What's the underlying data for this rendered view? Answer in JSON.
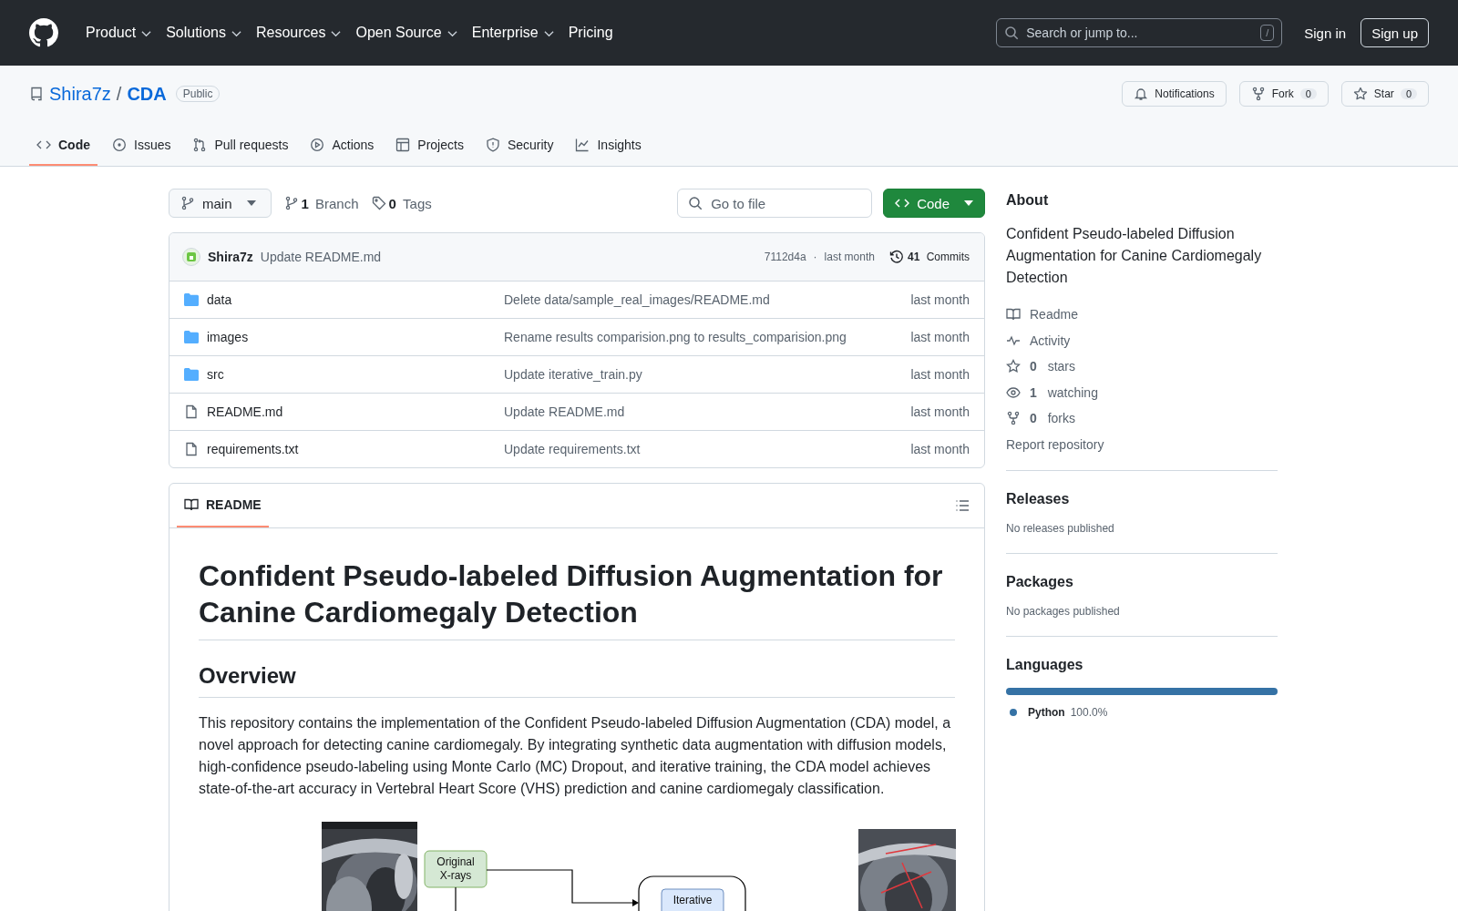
{
  "header": {
    "nav": [
      {
        "label": "Product",
        "dropdown": true
      },
      {
        "label": "Solutions",
        "dropdown": true
      },
      {
        "label": "Resources",
        "dropdown": true
      },
      {
        "label": "Open Source",
        "dropdown": true
      },
      {
        "label": "Enterprise",
        "dropdown": true
      },
      {
        "label": "Pricing",
        "dropdown": false
      }
    ],
    "search": {
      "placeholder": "Search or jump to...",
      "shortcut": "/"
    },
    "sign_in": "Sign in",
    "sign_up": "Sign up"
  },
  "repo": {
    "owner": "Shira7z",
    "separator": "/",
    "name": "CDA",
    "visibility": "Public",
    "actions": [
      {
        "label": "Notifications"
      },
      {
        "label": "Fork",
        "count": "0"
      },
      {
        "label": "Star",
        "count": "0"
      }
    ],
    "tabs": [
      {
        "label": "Code",
        "selected": true
      },
      {
        "label": "Issues",
        "selected": false
      },
      {
        "label": "Pull requests",
        "selected": false
      },
      {
        "label": "Actions",
        "selected": false
      },
      {
        "label": "Projects",
        "selected": false
      },
      {
        "label": "Security",
        "selected": false
      },
      {
        "label": "Insights",
        "selected": false
      }
    ]
  },
  "toolbar": {
    "branch": "main",
    "branch_count": "1",
    "branch_label": "Branch",
    "tag_count": "0",
    "tag_label": "Tags",
    "go_to_file": {
      "placeholder": "Go to file"
    },
    "code_button": "Code"
  },
  "commit": {
    "author": "Shira7z",
    "message": "Update README.md",
    "hash": "7112d4a",
    "separator": "·",
    "time": "last month",
    "count": "41",
    "count_label": "Commits"
  },
  "files": [
    {
      "kind": "folder",
      "name": "data",
      "message": "Delete data/sample_real_images/README.md",
      "time": "last month"
    },
    {
      "kind": "folder",
      "name": "images",
      "message": "Rename results comparision.png to results_comparision.png",
      "time": "last month"
    },
    {
      "kind": "folder",
      "name": "src",
      "message": "Update iterative_train.py",
      "time": "last month"
    },
    {
      "kind": "file",
      "name": "README.md",
      "message": "Update README.md",
      "time": "last month"
    },
    {
      "kind": "file",
      "name": "requirements.txt",
      "message": "Update requirements.txt",
      "time": "last month"
    }
  ],
  "readme": {
    "tab": {
      "label": "README",
      "selected": true
    },
    "title": "Confident Pseudo-labeled Diffusion Augmentation for Canine Cardiomegaly Detection",
    "overview_heading": "Overview",
    "paragraph": "This repository contains the implementation of the Confident Pseudo-labeled Diffusion Augmentation (CDA) model, a novel approach for detecting canine cardiomegaly. By integrating synthetic data augmentation with diffusion models, high-confidence pseudo-labeling using Monte Carlo (MC) Dropout, and iterative training, the CDA model achieves state-of-the-art accuracy in Vertebral Heart Score (VHS) prediction and canine cardiomegaly classification.",
    "figure": {
      "nodes": [
        {
          "lines": [
            "Original",
            "X-rays"
          ]
        },
        {
          "lines": [
            "Iterative"
          ]
        }
      ]
    }
  },
  "sidebar": {
    "about": {
      "title": "About",
      "description": "Confident Pseudo-labeled Diffusion Augmentation for Canine Cardiomegaly Detection",
      "links": [
        {
          "label": "Readme"
        },
        {
          "label": "Activity"
        },
        {
          "count": "0",
          "label": "stars"
        },
        {
          "count": "1",
          "label": "watching"
        },
        {
          "count": "0",
          "label": "forks"
        }
      ],
      "report": "Report repository"
    },
    "releases": {
      "title": "Releases",
      "empty": "No releases published"
    },
    "packages": {
      "title": "Packages",
      "empty": "No packages published"
    },
    "languages": {
      "title": "Languages",
      "items": [
        {
          "name": "Python",
          "percent": "100.0%",
          "color": "#3572a5",
          "level": 1
        }
      ]
    }
  }
}
